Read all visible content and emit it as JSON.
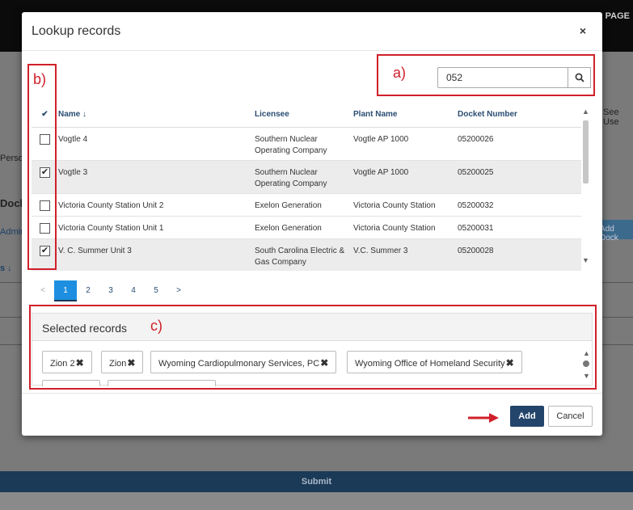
{
  "background": {
    "page_label": "PAGE",
    "person_fragment": "Perso",
    "docket_fragment": "Docke",
    "admin_fragment": "Admin",
    "see_use_fragment": "See Use",
    "add_docket_fragment": "Add Dock",
    "sort_fragment": "s ↓",
    "submit_label": "Submit"
  },
  "modal": {
    "title": "Lookup records",
    "close_glyph": "×",
    "search": {
      "value": "052",
      "placeholder": ""
    },
    "table": {
      "check_header": "✔",
      "columns": [
        "Name ↓",
        "Licensee",
        "Plant Name",
        "Docket Number"
      ],
      "rows": [
        {
          "checked": false,
          "name": "Vogtle 4",
          "licensee": "Southern Nuclear Operating Company",
          "plant": "Vogtle AP 1000",
          "docket": "05200026"
        },
        {
          "checked": true,
          "name": "Vogtle 3",
          "licensee": "Southern Nuclear Operating Company",
          "plant": "Vogtle AP 1000",
          "docket": "05200025"
        },
        {
          "checked": false,
          "name": "Victoria County Station Unit 2",
          "licensee": "Exelon Generation",
          "plant": "Victoria County Station",
          "docket": "05200032"
        },
        {
          "checked": false,
          "name": "Victoria County Station Unit 1",
          "licensee": "Exelon Generation",
          "plant": "Victoria County Station",
          "docket": "05200031"
        },
        {
          "checked": true,
          "name": "V. C. Summer Unit 3",
          "licensee": "South Carolina Electric & Gas Company",
          "plant": "V.C. Summer 3",
          "docket": "05200028"
        }
      ]
    },
    "pager": {
      "prev": "<",
      "pages": [
        "1",
        "2",
        "3",
        "4",
        "5"
      ],
      "next": ">",
      "active": "1"
    },
    "selected": {
      "heading": "Selected records",
      "remove_glyph": "✖",
      "tags": [
        "Zion 2",
        "Zion",
        "Wyoming Cardiopulmonary Services, PC",
        "Wyoming Office of Homeland Security"
      ]
    },
    "footer": {
      "add_label": "Add",
      "cancel_label": "Cancel"
    }
  },
  "annotations": {
    "a": "a)",
    "b": "b)",
    "c": "c)"
  },
  "colors": {
    "accent": "#23456b",
    "active_page": "#1e8fe0",
    "annotation": "#d0202a"
  }
}
